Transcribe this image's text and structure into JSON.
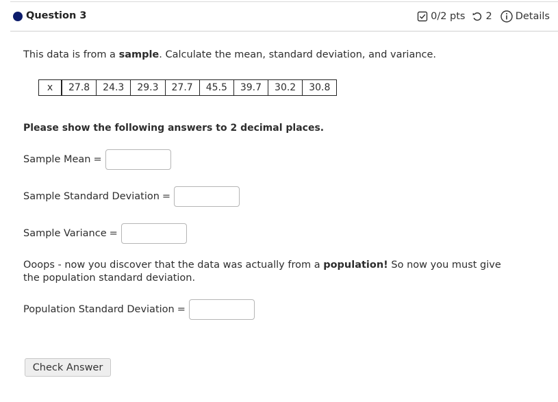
{
  "header": {
    "question_title": "Question 3",
    "points": "0/2 pts",
    "attempts": "2",
    "details_label": "Details"
  },
  "prompt": {
    "part1": "This data is from a ",
    "part2": "sample",
    "part3": ". Calculate the mean, standard deviation, and variance."
  },
  "data_table": {
    "label": "x",
    "values": [
      "27.8",
      "24.3",
      "29.3",
      "27.7",
      "45.5",
      "39.7",
      "30.2",
      "30.8"
    ]
  },
  "instruction": "Please show the following answers to 2 decimal places.",
  "fields": {
    "sample_mean": {
      "label": "Sample Mean",
      "eq": "=",
      "value": ""
    },
    "sample_sd": {
      "label": "Sample Standard Deviation",
      "eq": "=",
      "value": ""
    },
    "sample_variance": {
      "label": "Sample Variance",
      "eq": "=",
      "value": ""
    },
    "population_sd": {
      "label": "Population Standard Deviation",
      "eq": "=",
      "value": ""
    }
  },
  "oops": {
    "part1": "Ooops - now you discover that the data was actually from a ",
    "part2": "population!",
    "part3": " So now you must give the population standard deviation."
  },
  "check_button": "Check Answer",
  "colors": {
    "question_dot": "#0c1c6b",
    "border": "#222222"
  }
}
